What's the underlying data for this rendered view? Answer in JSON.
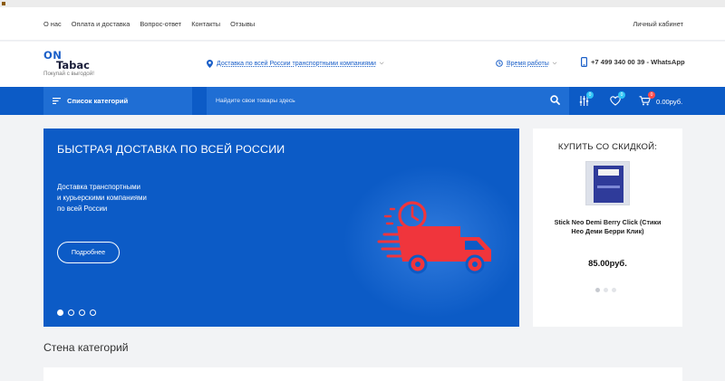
{
  "topbar": {
    "links": [
      "О нас",
      "Оплата и доставка",
      "Вопрос-ответ",
      "Контакты",
      "Отзывы"
    ],
    "cabinet": "Личный кабинет"
  },
  "header": {
    "logo_on": "ON",
    "logo_tabac": "Tabac",
    "logo_tagline": "Покупай с выгодой!",
    "delivery_text": "Доставка по всей России транспортными компаниями",
    "hours_text": "Время работы",
    "phone": "+7 499 340 00 39 - WhatsApp"
  },
  "navbar": {
    "categories_label": "Список категорий",
    "search_placeholder": "Найдите свои товары здесь",
    "compare_count": "0",
    "favorites_count": "0",
    "cart_count": "0",
    "cart_total": "0.00руб."
  },
  "slider": {
    "title": "БЫСТРАЯ ДОСТАВКА ПО ВСЕЙ РОССИИ",
    "description_lines": [
      "Доставка транспортными",
      "и курьерскими компаниями",
      "по всей России"
    ],
    "button_label": "Подробнее",
    "slide_count": 4,
    "active_slide": 1
  },
  "discount": {
    "title": "КУПИТЬ СО СКИДКОЙ:",
    "product_name": "Stick Neo Demi Berry Click (Стики Нео Деми Берри Клик)",
    "price": "85.00руб.",
    "page_count": 3,
    "active_page": 1
  },
  "section": {
    "title": "Стена категорий"
  },
  "colors": {
    "primary": "#0c5bc6",
    "navbar_item": "#1f6ed4",
    "truck": "#f0353c",
    "badge": "#2ec4f5",
    "cart_badge": "#ff4b4b"
  }
}
